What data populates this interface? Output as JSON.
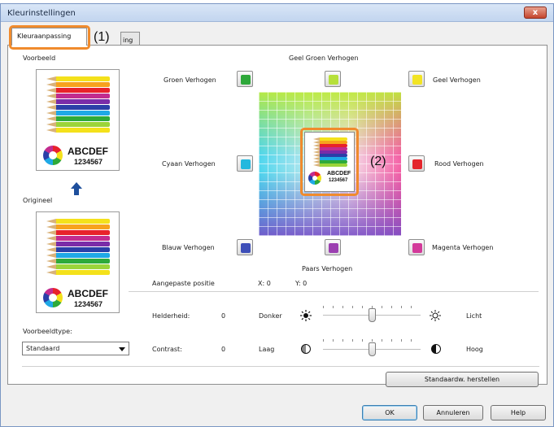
{
  "window": {
    "title": "Kleurinstellingen",
    "close_glyph": "x"
  },
  "tabs": [
    {
      "label": "Kleuraanpassing",
      "active": true
    },
    {
      "label": "ing",
      "active": false
    }
  ],
  "callouts": {
    "one": "(1)",
    "two": "(2)"
  },
  "left_panel": {
    "preview_label": "Voorbeeld",
    "original_label": "Origineel",
    "sample_text": "ABCDEF",
    "sample_number": "1234567",
    "preview_type_label": "Voorbeeldtype:",
    "preview_type_value": "Standaard"
  },
  "color_adjust": {
    "yellow_green": "Geel Groen Verhogen",
    "green": "Groen Verhogen",
    "yellow": "Geel Verhogen",
    "cyan": "Cyaan Verhogen",
    "red": "Rood Verhogen",
    "blue": "Blauw Verhogen",
    "magenta": "Magenta Verhogen",
    "purple": "Paars Verhogen",
    "swatches": {
      "green": "#2ea83a",
      "yellow_green": "#b6e03a",
      "yellow": "#f2e424",
      "cyan": "#23b8de",
      "red": "#e4252c",
      "blue": "#3d4eb8",
      "purple": "#9b3fb0",
      "magenta": "#d33a9a"
    }
  },
  "position": {
    "label": "Aangepaste positie",
    "x": "X: 0",
    "y": "Y: 0"
  },
  "brightness": {
    "label": "Helderheid:",
    "value": "0",
    "low": "Donker",
    "high": "Licht",
    "level": 0.5
  },
  "contrast": {
    "label": "Contrast:",
    "value": "0",
    "low": "Laag",
    "high": "Hoog",
    "level": 0.5
  },
  "buttons": {
    "restore_defaults": "Standaardw. herstellen",
    "ok": "OK",
    "cancel": "Annuleren",
    "help": "Help"
  },
  "accent_colors": {
    "highlight": "#f08b2d",
    "title_bar": "#c2d5ef"
  }
}
